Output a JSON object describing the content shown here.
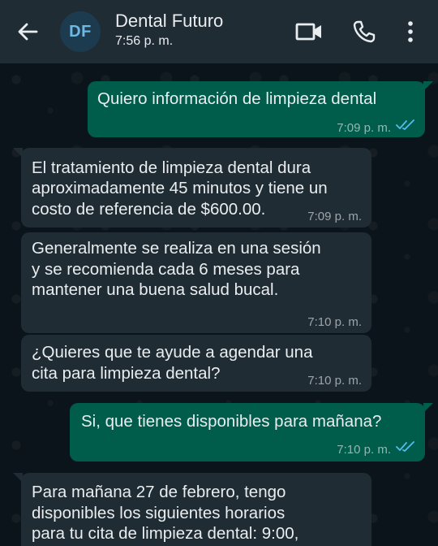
{
  "header": {
    "avatar_initials": "DF",
    "contact_name": "Dental Futuro",
    "status": "7:56 p. m.",
    "icons": [
      "back-arrow-icon",
      "video-camera-icon",
      "phone-icon",
      "more-vert-icon"
    ],
    "colors": {
      "header_bg": "#1f2c34",
      "chat_bg": "#0b141a",
      "outgoing_bubble": "#005c4b",
      "incoming_bubble": "#202c33",
      "read_ticks": "#53bdeb"
    }
  },
  "messages": [
    {
      "direction": "outgoing",
      "lines": [
        "Quiero información de limpieza dental"
      ],
      "time": "7:09 p. m.",
      "status": "read"
    },
    {
      "direction": "incoming",
      "lines": [
        "El tratamiento de limpieza dental dura",
        "aproximadamente 45 minutos y tiene un",
        "costo de referencia de $600.00."
      ],
      "time": "7:09 p. m."
    },
    {
      "direction": "incoming",
      "lines": [
        "Generalmente se realiza en una sesión",
        "y se recomienda cada 6 meses para",
        "mantener una buena salud bucal."
      ],
      "time": "7:10 p. m."
    },
    {
      "direction": "incoming",
      "lines": [
        "¿Quieres que te ayude a agendar una",
        "cita para limpieza dental?"
      ],
      "time": "7:10 p. m."
    },
    {
      "direction": "outgoing",
      "lines": [
        "Si, que tienes disponibles para mañana?"
      ],
      "time": "7:10 p. m.",
      "status": "read"
    },
    {
      "direction": "incoming",
      "lines": [
        "Para mañana 27 de febrero, tengo",
        "disponibles los siguientes horarios",
        "para tu cita de limpieza dental: 9:00,"
      ],
      "time": ""
    }
  ]
}
